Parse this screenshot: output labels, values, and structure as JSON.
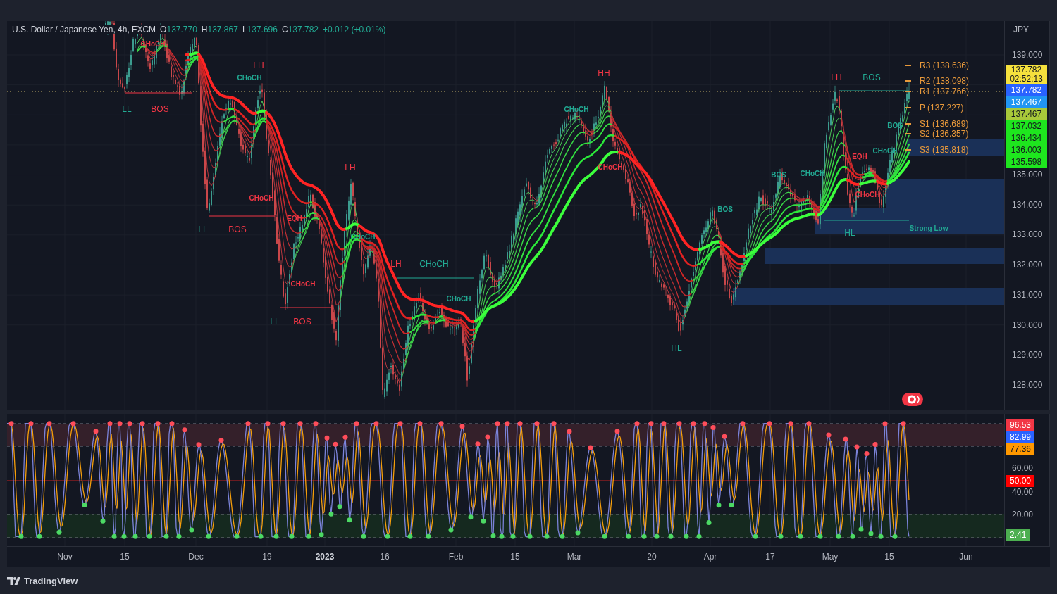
{
  "header": {
    "symbol": "U.S. Dollar / Japanese Yen, 4h, FXCM",
    "ohlc": [
      {
        "label": "O",
        "value": "137.770"
      },
      {
        "label": "H",
        "value": "137.867"
      },
      {
        "label": "L",
        "value": "137.696"
      },
      {
        "label": "C",
        "value": "137.782"
      }
    ],
    "change": "+0.012 (+0.01%)"
  },
  "structure_labels": [
    {
      "text": "CHoCH",
      "kind": "minor",
      "color": "#f23645"
    },
    {
      "text": "LH",
      "kind": "swing",
      "color": "#f23645"
    },
    {
      "text": "CHoCH",
      "kind": "minor",
      "color": "#22ab94"
    },
    {
      "text": "HH",
      "kind": "swing",
      "color": "#f23645"
    },
    {
      "text": "LH",
      "kind": "swing",
      "color": "#f23645"
    },
    {
      "text": "BOS",
      "kind": "swing",
      "color": "#22ab94"
    },
    {
      "text": "LL",
      "kind": "swing",
      "color": "#22ab94"
    },
    {
      "text": "BOS",
      "kind": "swing",
      "color": "#f23645"
    },
    {
      "text": "CHoCH",
      "kind": "minor",
      "color": "#22ab94"
    },
    {
      "text": "BOS",
      "kind": "minor",
      "color": "#22ab94"
    },
    {
      "text": "EQH",
      "kind": "minor",
      "color": "#f23645"
    },
    {
      "text": "CHoCH",
      "kind": "minor",
      "color": "#22ab94"
    },
    {
      "text": "LH",
      "kind": "swing",
      "color": "#f23645"
    },
    {
      "text": "CHoCH",
      "kind": "minor",
      "color": "#f23645"
    },
    {
      "text": "BOS",
      "kind": "minor",
      "color": "#22ab94"
    },
    {
      "text": "CHoCH",
      "kind": "minor",
      "color": "#22ab94"
    },
    {
      "text": "CHoCH",
      "kind": "minor",
      "color": "#f23645"
    },
    {
      "text": "CHoCH",
      "kind": "minor",
      "color": "#f23645"
    },
    {
      "text": "BOS",
      "kind": "minor",
      "color": "#22ab94"
    },
    {
      "text": "EQH",
      "kind": "minor",
      "color": "#f23645"
    },
    {
      "text": "LL",
      "kind": "swing",
      "color": "#22ab94"
    },
    {
      "text": "BOS",
      "kind": "swing",
      "color": "#f23645"
    },
    {
      "text": "CHoCH",
      "kind": "minor",
      "color": "#22ab94"
    },
    {
      "text": "HL",
      "kind": "swing",
      "color": "#22ab94"
    },
    {
      "text": "Strong Low",
      "kind": "minor",
      "color": "#22ab94"
    },
    {
      "text": "LH",
      "kind": "swing",
      "color": "#f23645"
    },
    {
      "text": "CHoCH",
      "kind": "swing",
      "color": "#22ab94"
    },
    {
      "text": "CHoCH",
      "kind": "minor",
      "color": "#f23645"
    },
    {
      "text": "CHoCH",
      "kind": "minor",
      "color": "#22ab94"
    },
    {
      "text": "LL",
      "kind": "swing",
      "color": "#22ab94"
    },
    {
      "text": "BOS",
      "kind": "swing",
      "color": "#f23645"
    },
    {
      "text": "HL",
      "kind": "swing",
      "color": "#22ab94"
    }
  ],
  "pivot_levels": [
    "R3 (138.636)",
    "R2 (138.098)",
    "R1 (137.766)",
    "P (137.227)",
    "S1 (136.689)",
    "S2 (136.357)",
    "S3 (135.818)"
  ],
  "price_axis": {
    "currency": "JPY",
    "ticks": [
      "139.000",
      "135.000",
      "134.000",
      "133.000",
      "132.000",
      "131.000",
      "130.000",
      "129.000",
      "128.000"
    ],
    "badges": [
      {
        "value": "137.782",
        "countdown": "02:52:13",
        "color": "#f5e13d"
      },
      {
        "value": "137.782",
        "color": "#2962ff"
      },
      {
        "value": "137.467",
        "color": "#2196f3"
      },
      {
        "value": "137.467",
        "color": "#a8c93a"
      },
      {
        "value": "137.032",
        "color": "#1ee61e"
      },
      {
        "value": "136.434",
        "color": "#1ee61e"
      },
      {
        "value": "136.003",
        "color": "#1ee61e"
      },
      {
        "value": "135.598",
        "color": "#1ee61e"
      }
    ]
  },
  "oscillator": {
    "ticks": [
      "60.00",
      "40.00",
      "20.00"
    ],
    "badges": [
      {
        "value": "96.53",
        "color": "#f23645"
      },
      {
        "value": "82.99",
        "color": "#2962ff"
      },
      {
        "value": "77.36",
        "color": "#ff9800"
      },
      {
        "value": "50.00",
        "color": "#ff0000"
      },
      {
        "value": "2.41",
        "color": "#4caf50"
      }
    ]
  },
  "time_axis": [
    {
      "text": "Nov",
      "kind": "date"
    },
    {
      "text": "15",
      "kind": "date"
    },
    {
      "text": "Dec",
      "kind": "date"
    },
    {
      "text": "19",
      "kind": "date"
    },
    {
      "text": "2023",
      "kind": "year"
    },
    {
      "text": "16",
      "kind": "date"
    },
    {
      "text": "Feb",
      "kind": "date"
    },
    {
      "text": "15",
      "kind": "date"
    },
    {
      "text": "Mar",
      "kind": "date"
    },
    {
      "text": "20",
      "kind": "date"
    },
    {
      "text": "Apr",
      "kind": "date"
    },
    {
      "text": "17",
      "kind": "date"
    },
    {
      "text": "May",
      "kind": "date"
    },
    {
      "text": "15",
      "kind": "date"
    },
    {
      "text": "Jun",
      "kind": "date"
    }
  ],
  "footer": {
    "brand": "TradingView"
  }
}
